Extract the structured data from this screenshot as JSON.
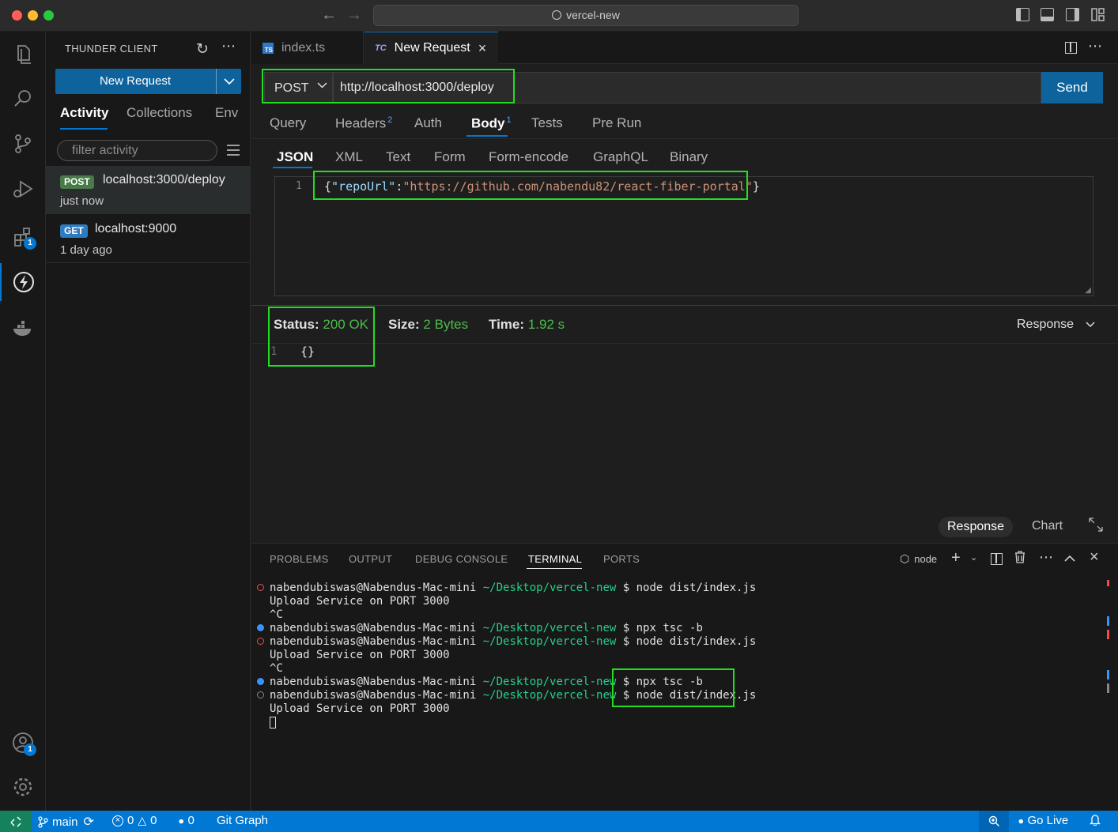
{
  "window": {
    "title": "vercel-new"
  },
  "sidebar": {
    "title": "THUNDER CLIENT",
    "new_request_label": "New Request",
    "tabs": [
      "Activity",
      "Collections",
      "Env"
    ],
    "filter_placeholder": "filter activity",
    "activity": [
      {
        "method": "POST",
        "url": "localhost:3000/deploy",
        "time": "just now"
      },
      {
        "method": "GET",
        "url": "localhost:9000",
        "time": "1 day ago"
      }
    ]
  },
  "activity_badges": {
    "extensions": "1",
    "accounts": "1"
  },
  "editor_tabs": [
    {
      "label": "index.ts",
      "icon": "ts-file-icon"
    },
    {
      "label": "New Request",
      "icon": "thunder-client-icon"
    }
  ],
  "request": {
    "method": "POST",
    "url": "http://localhost:3000/deploy",
    "send_label": "Send",
    "tabs": [
      "Query",
      "Headers",
      "Auth",
      "Body",
      "Tests",
      "Pre Run"
    ],
    "headers_count": "2",
    "body_count": "1",
    "body_tabs": [
      "JSON",
      "XML",
      "Text",
      "Form",
      "Form-encode",
      "GraphQL",
      "Binary"
    ],
    "body_line_no": "1",
    "body_json": {
      "open": "{",
      "key": "\"repoUrl\"",
      "colon": ":",
      "value": "\"https://github.com/nabendu82/react-fiber-portal\"",
      "close": "}"
    }
  },
  "response": {
    "status_label": "Status:",
    "status_value": "200 OK",
    "size_label": "Size:",
    "size_value": "2 Bytes",
    "time_label": "Time:",
    "time_value": "1.92 s",
    "view_select": "Response",
    "line_no": "1",
    "body": "{}",
    "bottom_tabs": [
      "Response",
      "Chart"
    ]
  },
  "panel": {
    "tabs": [
      "PROBLEMS",
      "OUTPUT",
      "DEBUG CONSOLE",
      "TERMINAL",
      "PORTS"
    ],
    "terminal_name": "node",
    "lines": [
      {
        "dot": "error",
        "user": "nabendubiswas@Nabendus-Mac-mini",
        "path": "~/Desktop/vercel-new",
        "cmd": "$ node dist/index.js"
      },
      {
        "dot": "",
        "text": "Upload Service on PORT 3000"
      },
      {
        "dot": "",
        "text": "^C"
      },
      {
        "dot": "info",
        "user": "nabendubiswas@Nabendus-Mac-mini",
        "path": "~/Desktop/vercel-new",
        "cmd": "$ npx tsc -b"
      },
      {
        "dot": "error",
        "user": "nabendubiswas@Nabendus-Mac-mini",
        "path": "~/Desktop/vercel-new",
        "cmd": "$ node dist/index.js"
      },
      {
        "dot": "",
        "text": "Upload Service on PORT 3000"
      },
      {
        "dot": "",
        "text": "^C"
      },
      {
        "dot": "info",
        "user": "nabendubiswas@Nabendus-Mac-mini",
        "path": "~/Desktop/vercel-new",
        "cmd": "$ npx tsc -b"
      },
      {
        "dot": "pending",
        "user": "nabendubiswas@Nabendus-Mac-mini",
        "path": "~/Desktop/vercel-new",
        "cmd": "$ node dist/index.js"
      },
      {
        "dot": "",
        "text": "Upload Service on PORT 3000"
      }
    ]
  },
  "statusbar": {
    "branch": "main",
    "errors": "0",
    "warnings": "0",
    "ports": "0",
    "git_graph": "Git Graph",
    "go_live": "Go Live"
  },
  "colors": {
    "accent": "#0078d4",
    "success": "#4cbb4c",
    "highlight_box": "#22dd22",
    "remote": "#16825d"
  }
}
